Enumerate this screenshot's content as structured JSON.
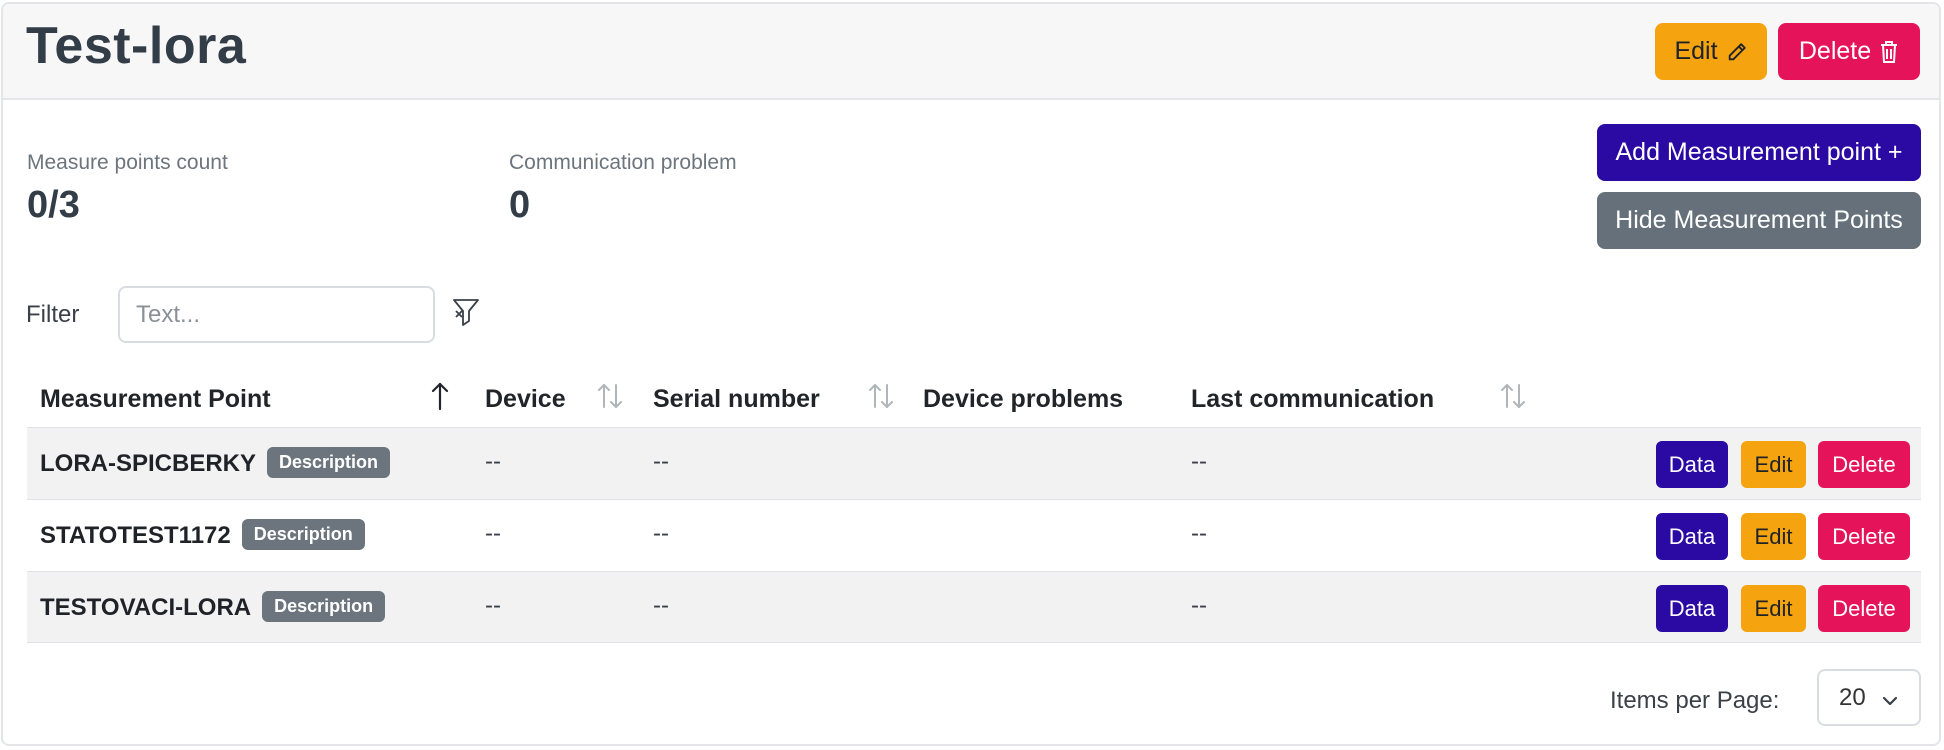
{
  "header": {
    "title": "Test-lora",
    "edit_label": "Edit",
    "delete_label": "Delete"
  },
  "stats": {
    "measure_points_label": "Measure points count",
    "measure_points_value": "0/3",
    "communication_label": "Communication problem",
    "communication_value": "0"
  },
  "actions": {
    "add_label": "Add Measurement point +",
    "hide_label": "Hide Measurement Points"
  },
  "filter": {
    "label": "Filter",
    "placeholder": "Text..."
  },
  "table": {
    "columns": [
      {
        "label": "Measurement Point"
      },
      {
        "label": "Device"
      },
      {
        "label": "Serial number"
      },
      {
        "label": "Device problems"
      },
      {
        "label": "Last communication"
      }
    ],
    "rows": [
      {
        "name": "LORA-SPICBERKY",
        "badge": "Description",
        "device": "--",
        "serial": "--",
        "problems": "",
        "last": "--"
      },
      {
        "name": "STATOTEST1172",
        "badge": "Description",
        "device": "--",
        "serial": "--",
        "problems": "",
        "last": "--"
      },
      {
        "name": "TESTOVACI-LORA",
        "badge": "Description",
        "device": "--",
        "serial": "--",
        "problems": "",
        "last": "--"
      }
    ],
    "row_actions": {
      "data_label": "Data",
      "edit_label": "Edit",
      "delete_label": "Delete"
    }
  },
  "pagination": {
    "label": "Items per Page:",
    "value": "20"
  },
  "colors": {
    "warning": "#f5a30f",
    "danger": "#e5145a",
    "primary": "#2b0aa4",
    "secondary": "#65707b"
  }
}
